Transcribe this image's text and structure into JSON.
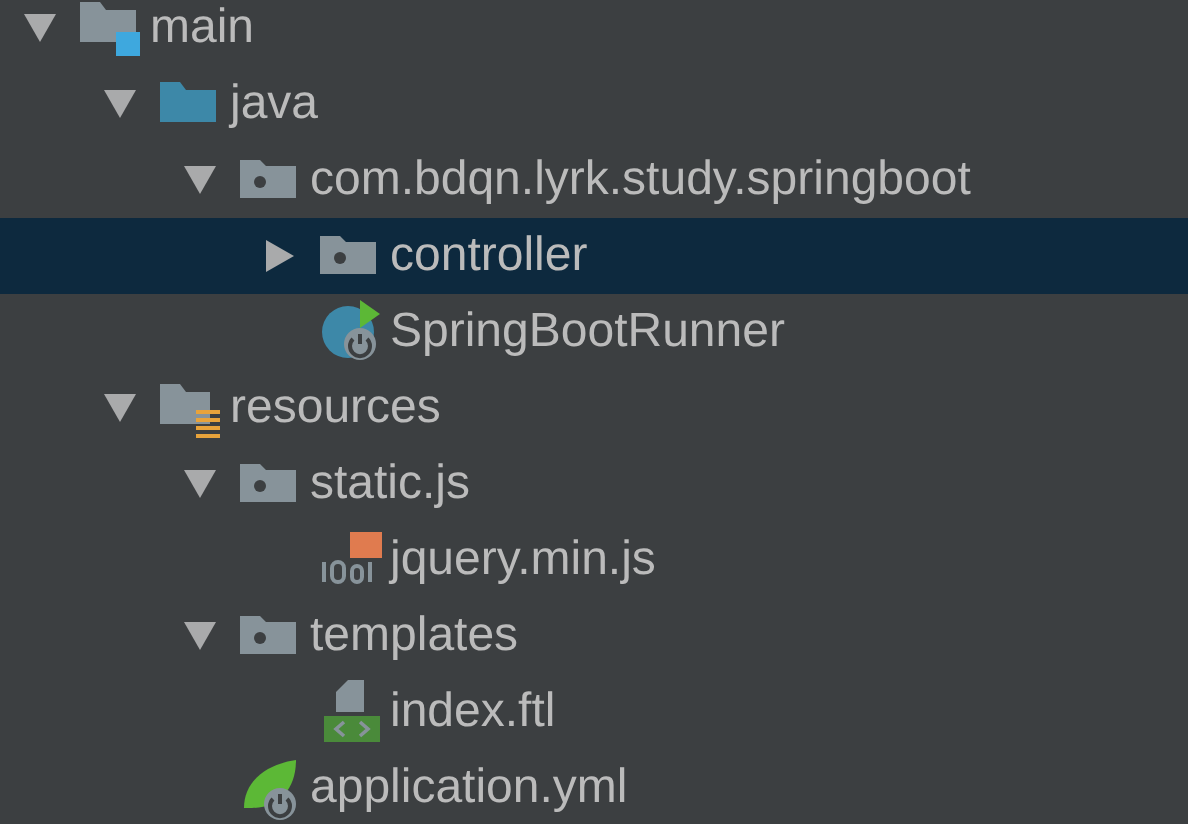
{
  "tree": [
    {
      "label": "main",
      "kind": "source-root",
      "expanded": true,
      "selected": false,
      "children": [
        {
          "label": "java",
          "kind": "java-root",
          "expanded": true,
          "selected": false,
          "children": [
            {
              "label": "com.bdqn.lyrk.study.springboot",
              "kind": "package",
              "expanded": true,
              "selected": false,
              "children": [
                {
                  "label": "controller",
                  "kind": "package",
                  "expanded": false,
                  "selected": true
                },
                {
                  "label": "SpringBootRunner",
                  "kind": "spring-class",
                  "selected": false
                }
              ]
            }
          ]
        },
        {
          "label": "resources",
          "kind": "resources-root",
          "expanded": true,
          "selected": false,
          "children": [
            {
              "label": "static.js",
              "kind": "package",
              "expanded": true,
              "selected": false,
              "children": [
                {
                  "label": "jquery.min.js",
                  "kind": "js-file",
                  "selected": false
                }
              ]
            },
            {
              "label": "templates",
              "kind": "package",
              "expanded": true,
              "selected": false,
              "children": [
                {
                  "label": "index.ftl",
                  "kind": "template-file",
                  "selected": false
                }
              ]
            },
            {
              "label": "application.yml",
              "kind": "spring-config",
              "selected": false
            }
          ]
        }
      ]
    }
  ]
}
